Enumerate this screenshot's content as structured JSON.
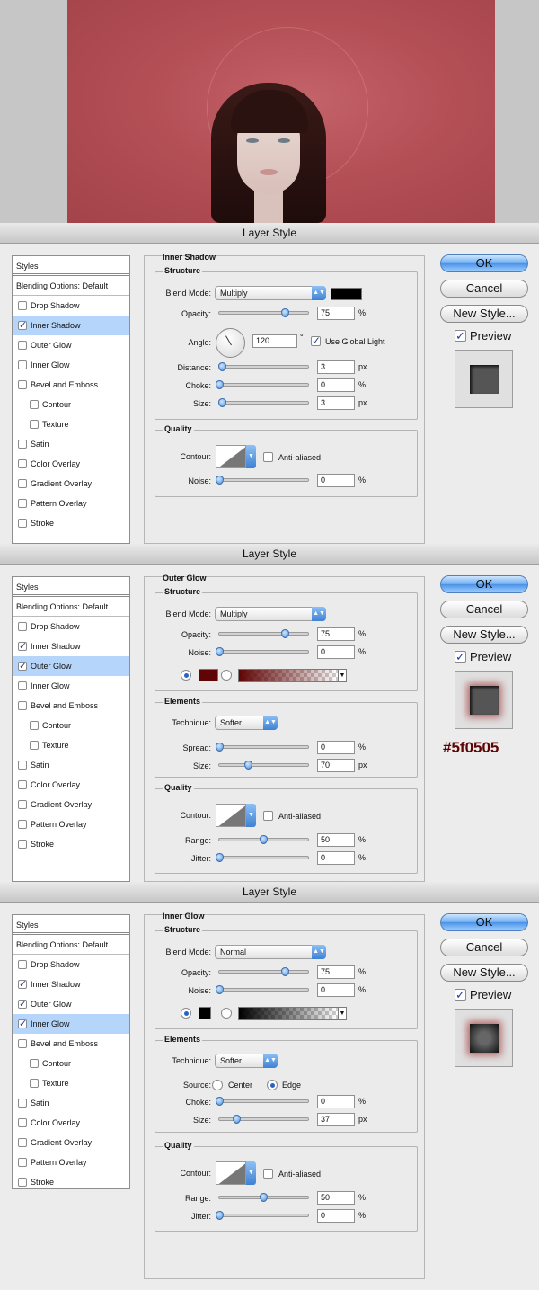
{
  "dialog_title": "Layer Style",
  "styles_panel": {
    "header": "Styles",
    "blending": "Blending Options: Default",
    "items": [
      "Drop Shadow",
      "Inner Shadow",
      "Outer Glow",
      "Inner Glow",
      "Bevel and Emboss",
      "Contour",
      "Texture",
      "Satin",
      "Color Overlay",
      "Gradient Overlay",
      "Pattern Overlay",
      "Stroke"
    ]
  },
  "buttons": {
    "ok": "OK",
    "cancel": "Cancel",
    "new_style": "New Style...",
    "preview": "Preview"
  },
  "common": {
    "structure": "Structure",
    "quality": "Quality",
    "elements": "Elements",
    "blend_mode": "Blend Mode:",
    "opacity": "Opacity:",
    "noise": "Noise:",
    "contour": "Contour:",
    "anti_aliased": "Anti-aliased",
    "range": "Range:",
    "jitter": "Jitter:",
    "technique": "Technique:",
    "size": "Size:",
    "choke": "Choke:",
    "spread": "Spread:",
    "pct": "%",
    "px": "px"
  },
  "dialog1": {
    "section": "Inner Shadow",
    "checked": [
      "Inner Shadow"
    ],
    "selected": "Inner Shadow",
    "blend_mode": "Multiply",
    "shadow_color": "#000000",
    "opacity": "75",
    "angle_label": "Angle:",
    "angle": "120",
    "degree": "°",
    "use_global_light": "Use Global Light",
    "distance_label": "Distance:",
    "distance": "3",
    "choke": "0",
    "size": "3",
    "noise": "0"
  },
  "dialog2": {
    "section": "Outer Glow",
    "checked": [
      "Inner Shadow",
      "Outer Glow"
    ],
    "selected": "Outer Glow",
    "blend_mode": "Multiply",
    "opacity": "75",
    "noise": "0",
    "glow_color": "#5f0505",
    "technique": "Softer",
    "spread": "0",
    "size": "70",
    "range": "50",
    "jitter": "0",
    "hex_label": "#5f0505"
  },
  "dialog3": {
    "section": "Inner Glow",
    "checked": [
      "Inner Shadow",
      "Outer Glow",
      "Inner Glow"
    ],
    "selected": "Inner Glow",
    "blend_mode": "Normal",
    "opacity": "75",
    "noise": "0",
    "glow_color": "#000000",
    "technique": "Softer",
    "source_label": "Source:",
    "source_center": "Center",
    "source_edge": "Edge",
    "choke": "0",
    "size": "37",
    "range": "50",
    "jitter": "0"
  }
}
